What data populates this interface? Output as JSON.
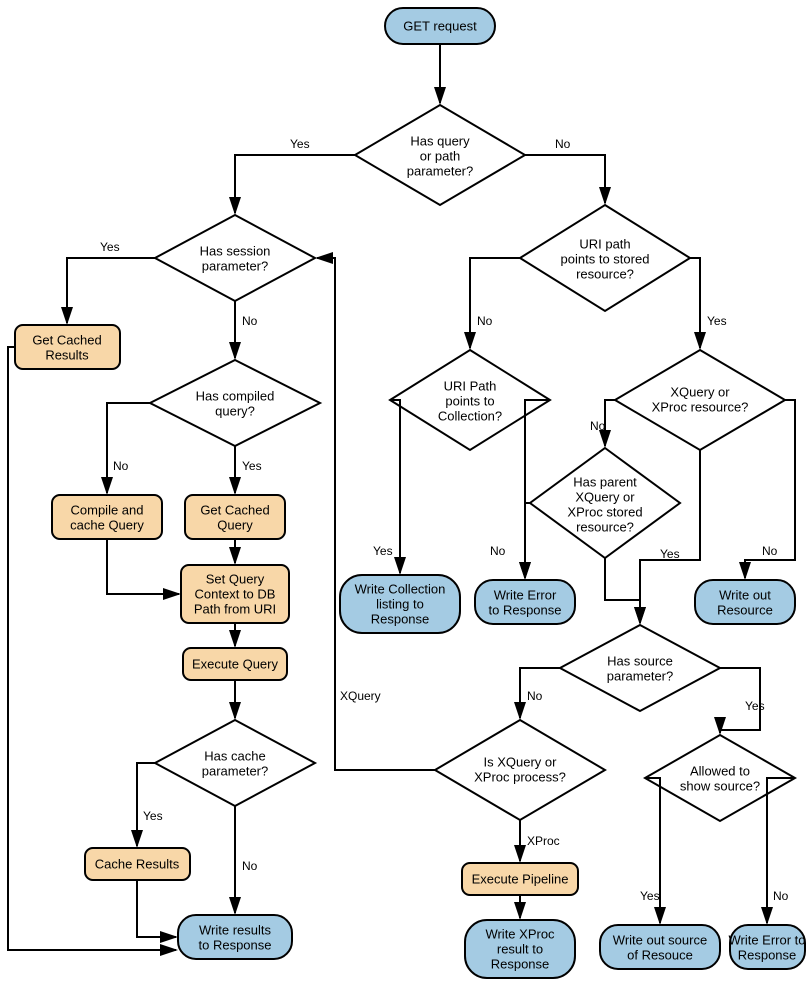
{
  "nodes": {
    "start": "GET request",
    "d1": "Has query or path parameter?",
    "d2": "Has session parameter?",
    "d3": "Has compiled query?",
    "d4": "Has cache parameter?",
    "d5": "URI path points to stored resource?",
    "d6": "URI Path points to Collection?",
    "d7": "XQuery or XProc resource?",
    "d8": "Has parent XQuery or XProc stored resource?",
    "d9": "Has source parameter?",
    "d10": "Is XQuery or XProc process?",
    "d11": "Allowed to show source?",
    "p1": "Get Cached Results",
    "p2": "Compile and cache Query",
    "p3": "Get Cached Query",
    "p4": "Set Query Context to DB Path from URI",
    "p5": "Execute Query",
    "p6": "Cache Results",
    "p7": "Execute Pipeline",
    "t1": "Write results to Response",
    "t2": "Write Collection listing to Response",
    "t3": "Write Error to Response",
    "t4": "Write out Resource",
    "t5": "Write XProc result to Response",
    "t6": "Write out source of Resouce",
    "t7": "Write Error to Response"
  },
  "labels": {
    "yes": "Yes",
    "no": "No",
    "xquery": "XQuery",
    "xproc": "XProc"
  }
}
